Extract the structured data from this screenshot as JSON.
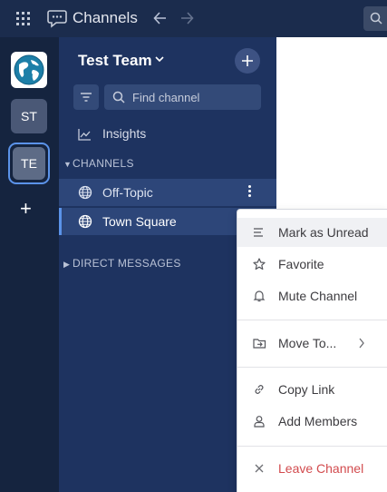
{
  "header": {
    "title": "Channels"
  },
  "teams": [
    {
      "initials": "ST"
    },
    {
      "initials": "TE"
    }
  ],
  "sidebar": {
    "team_name": "Test Team",
    "search_placeholder": "Find channel",
    "insights_label": "Insights",
    "channels_header": "CHANNELS",
    "channels": [
      {
        "name": "Off-Topic"
      },
      {
        "name": "Town Square"
      }
    ],
    "dm_header": "DIRECT MESSAGES"
  },
  "context_menu": {
    "items": [
      {
        "label": "Mark as Unread"
      },
      {
        "label": "Favorite"
      },
      {
        "label": "Mute Channel"
      },
      {
        "label": "Move To..."
      },
      {
        "label": "Copy Link"
      },
      {
        "label": "Add Members"
      },
      {
        "label": "Leave Channel"
      }
    ]
  },
  "colors": {
    "top_bar": "#1b2c4d",
    "team_sidebar": "#15243f",
    "channel_sidebar": "#1e3360",
    "active_accent": "#5b93e9",
    "danger": "#d24b4e"
  }
}
